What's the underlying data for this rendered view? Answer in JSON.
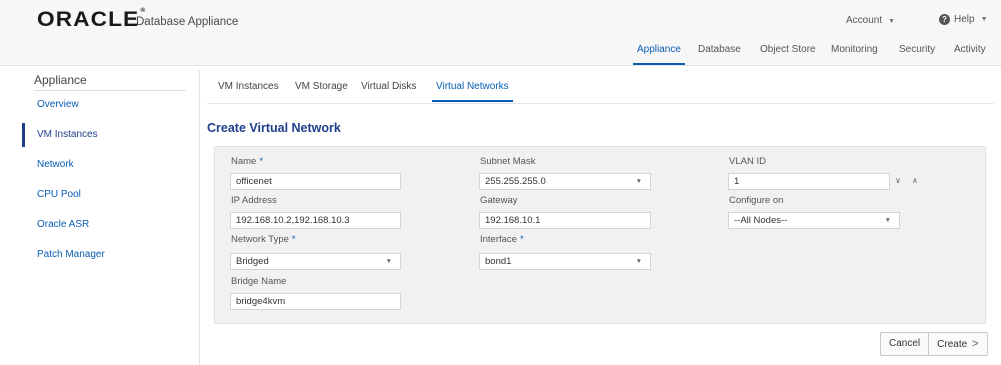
{
  "header": {
    "logo": "ORACLE",
    "product": "Database Appliance",
    "account_label": "Account",
    "help_label": "Help",
    "nav": [
      {
        "label": "Appliance",
        "active": true
      },
      {
        "label": "Database"
      },
      {
        "label": "Object Store"
      },
      {
        "label": "Monitoring"
      },
      {
        "label": "Security"
      },
      {
        "label": "Activity"
      }
    ]
  },
  "sidebar": {
    "title": "Appliance",
    "items": [
      {
        "label": "Overview"
      },
      {
        "label": "VM Instances",
        "active": true
      },
      {
        "label": "Network"
      },
      {
        "label": "CPU Pool"
      },
      {
        "label": "Oracle ASR"
      },
      {
        "label": "Patch Manager"
      }
    ]
  },
  "subtabs": [
    {
      "label": "VM Instances"
    },
    {
      "label": "VM Storage"
    },
    {
      "label": "Virtual Disks"
    },
    {
      "label": "Virtual Networks",
      "active": true
    }
  ],
  "page_title": "Create Virtual Network",
  "form": {
    "name": {
      "label": "Name",
      "value": "officenet",
      "required": true
    },
    "ip_address": {
      "label": "IP Address",
      "value": "192.168.10.2,192.168.10.3"
    },
    "network_type": {
      "label": "Network Type",
      "value": "Bridged",
      "required": true
    },
    "bridge_name": {
      "label": "Bridge Name",
      "value": "bridge4kvm"
    },
    "subnet_mask": {
      "label": "Subnet Mask",
      "value": "255.255.255.0"
    },
    "gateway": {
      "label": "Gateway",
      "value": "192.168.10.1"
    },
    "interface": {
      "label": "Interface",
      "value": "bond1",
      "required": true
    },
    "vlan_id": {
      "label": "VLAN ID",
      "value": "1"
    },
    "configure_on": {
      "label": "Configure on",
      "value": "--All Nodes--"
    },
    "required_marker": "*"
  },
  "buttons": {
    "cancel": "Cancel",
    "create": "Create"
  },
  "icons": {
    "dropdown": "caret-down-icon",
    "chevron_right": "chevron-right-icon",
    "help": "help-circle-icon"
  },
  "colors": {
    "accent": "#0a5db3",
    "title": "#1f3e8c",
    "panel": "#f1f1f1"
  }
}
